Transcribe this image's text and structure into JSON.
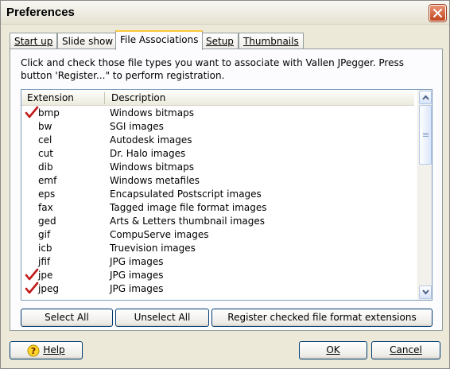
{
  "window": {
    "title": "Preferences",
    "close_icon": "close-icon"
  },
  "tabs": [
    {
      "label": "Start up",
      "active": false
    },
    {
      "label": "Slide show",
      "active": false
    },
    {
      "label": "File Associations",
      "active": true
    },
    {
      "label": "Setup",
      "active": false
    },
    {
      "label": "Thumbnails",
      "active": false
    }
  ],
  "instructions": "Click and check those file types you want to associate with Vallen JPegger. Press button 'Register...\" to perform registration.",
  "list": {
    "columns": [
      "Extension",
      "Description"
    ],
    "rows": [
      {
        "ext": "bmp",
        "desc": "Windows bitmaps",
        "checked": true
      },
      {
        "ext": "bw",
        "desc": "SGI images",
        "checked": false
      },
      {
        "ext": "cel",
        "desc": "Autodesk images",
        "checked": false
      },
      {
        "ext": "cut",
        "desc": "Dr. Halo images",
        "checked": false
      },
      {
        "ext": "dib",
        "desc": "Windows bitmaps",
        "checked": false
      },
      {
        "ext": "emf",
        "desc": "Windows metafiles",
        "checked": false
      },
      {
        "ext": "eps",
        "desc": "Encapsulated Postscript images",
        "checked": false
      },
      {
        "ext": "fax",
        "desc": "Tagged image file format images",
        "checked": false
      },
      {
        "ext": "ged",
        "desc": "Arts & Letters thumbnail images",
        "checked": false
      },
      {
        "ext": "gif",
        "desc": "CompuServe images",
        "checked": false
      },
      {
        "ext": "icb",
        "desc": "Truevision images",
        "checked": false
      },
      {
        "ext": "jfif",
        "desc": "JPG images",
        "checked": false
      },
      {
        "ext": "jpe",
        "desc": "JPG images",
        "checked": true
      },
      {
        "ext": "jpeg",
        "desc": "JPG images",
        "checked": true
      }
    ]
  },
  "buttons": {
    "select_all": "Select All",
    "unselect_all": "Unselect All",
    "register": "Register checked file format extensions",
    "help": "Help",
    "ok": "OK",
    "cancel": "Cancel"
  },
  "colors": {
    "check": "#c0191a",
    "tab_highlight": "#ffc83c",
    "border": "#003c74"
  }
}
